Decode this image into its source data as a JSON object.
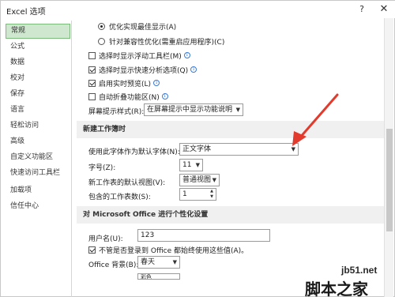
{
  "window": {
    "title": "Excel 选项",
    "help_label": "?",
    "close_label": "✕"
  },
  "sidebar": {
    "items": [
      {
        "label": "常规",
        "active": true
      },
      {
        "label": "公式"
      },
      {
        "label": "数据"
      },
      {
        "label": "校对"
      },
      {
        "label": "保存"
      },
      {
        "label": "语言"
      },
      {
        "label": "轻松访问"
      },
      {
        "label": "高级"
      },
      {
        "label": "自定义功能区"
      },
      {
        "label": "快速访问工具栏"
      },
      {
        "label": "加载项"
      },
      {
        "label": "信任中心"
      }
    ]
  },
  "ui_options": {
    "radio_optimize_display": "优化实现最佳显示(A)",
    "radio_optimize_compat": "针对兼容性优化(需重启应用程序)(C)",
    "mini_toolbar": "选择时显示浮动工具栏(M)",
    "quick_analysis": "选择时显示快速分析选项(Q)",
    "live_preview": "启用实时预览(L)",
    "collapse_ribbon": "自动折叠功能区(N)",
    "screentip_label": "屏幕提示样式(R):",
    "screentip_value": "在屏幕提示中显示功能说明"
  },
  "new_workbook": {
    "header": "新建工作簿时",
    "font_label": "使用此字体作为默认字体(N):",
    "font_value": "正文字体",
    "size_label": "字号(Z):",
    "size_value": "11",
    "view_label": "新工作表的默认视图(V):",
    "view_value": "普通视图",
    "sheets_label": "包含的工作表数(S):",
    "sheets_value": "1"
  },
  "personalize": {
    "header": "对 Microsoft Office 进行个性化设置",
    "username_label": "用户名(U):",
    "username_value": "123",
    "always_use": "不管是否登录到 Office 都始终使用这些值(A)。",
    "background_label": "Office 背景(B):",
    "background_value": "春天",
    "theme_value": "彩色"
  },
  "watermark": {
    "url": "jb51.net",
    "text": "脚本之家"
  },
  "colors": {
    "accent_red": "#e23b2e",
    "active_green": "#cfe6cf"
  }
}
